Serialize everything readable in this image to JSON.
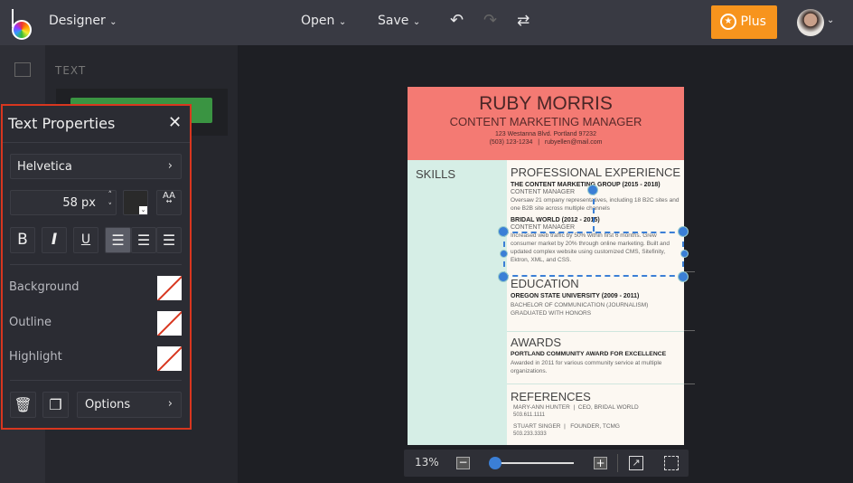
{
  "topbar": {
    "mode": "Designer",
    "open": "Open",
    "save": "Save",
    "plus": "Plus"
  },
  "sidebar": {
    "section": "TEXT"
  },
  "text_properties": {
    "title": "Text Properties",
    "font": "Helvetica",
    "size": "58 px",
    "bold": "B",
    "italic": "I",
    "underline": "U",
    "case": "AA",
    "background": "Background",
    "outline": "Outline",
    "highlight": "Highlight",
    "options": "Options"
  },
  "resume": {
    "name": "RUBY MORRIS",
    "title": "CONTENT MARKETING MANAGER",
    "address": "123 Westanna Blvd. Portland 97232",
    "contact": "(503) 123-1234   |   rubyellen@mail.com",
    "skills": "SKILLS",
    "exp": "PROFESSIONAL EXPERIENCE",
    "job1": "THE CONTENT MARKETING GROUP (2015 - 2018)",
    "job1_role": "CONTENT MANAGER",
    "job1_desc": "Oversaw 21 ompany representatives, including 18 B2C sites and one B2B site across multiple channels",
    "job2": "BRIDAL WORLD (2012 - 2015)",
    "job2_role": "CONTENT MANAGER",
    "job2_desc": "Increased web traffic by 50% within first 6 months. Grew consumer market by 20% through online marketing. Built and updated complex website using customized CMS, Sitefinity, Ektron, XML, and CSS.",
    "edu": "EDUCATION",
    "school": "OREGON STATE UNIVERSITY (2009 - 2011)",
    "degree": "BACHELOR OF COMMUNICATION (JOURNALISM)",
    "honors": "GRADUATED WITH HONORS",
    "awards": "AWARDS",
    "award": "PORTLAND COMMUNITY AWARD FOR EXCELLENCE",
    "award_desc": "Awarded in 2011 for various community service at multiple organizations.",
    "refs": "REFERENCES",
    "ref1": "MARY-ANN HUNTER  |  CEO, BRIDAL WORLD",
    "ref1_phone": "503.611.1111",
    "ref2": "STUART SINGER  |   FOUNDER, TCMG",
    "ref2_phone": "503.233.3333"
  },
  "zoom": {
    "level": "13%",
    "slider_fraction": 0.05
  },
  "colors": {
    "accent": "#f7941d",
    "selection": "#3b7fd6",
    "panel_border": "#d8361f"
  }
}
